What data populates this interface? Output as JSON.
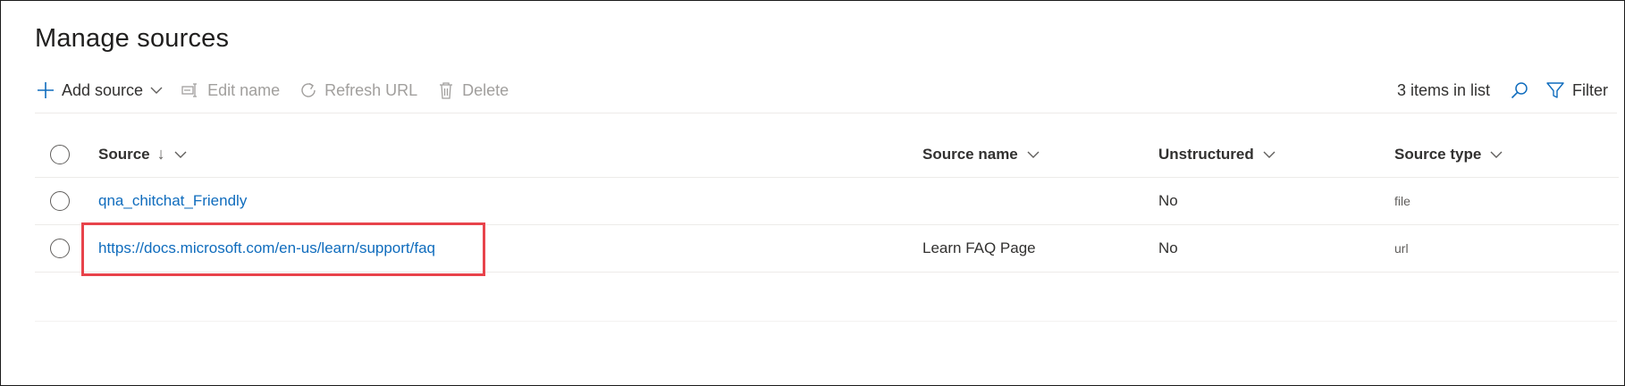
{
  "page": {
    "title": "Manage sources"
  },
  "toolbar": {
    "add_source": "Add source",
    "edit_name": "Edit name",
    "refresh_url": "Refresh URL",
    "delete": "Delete",
    "items_count": "3 items in list",
    "filter": "Filter",
    "icons": {
      "add": "plus-icon",
      "edit": "rename-icon",
      "refresh": "refresh-icon",
      "delete": "trash-icon",
      "search": "search-icon",
      "filter": "filter-icon"
    }
  },
  "table": {
    "columns": {
      "source": "Source",
      "source_sort_arrow": "↓",
      "source_name": "Source name",
      "unstructured": "Unstructured",
      "source_type": "Source type"
    },
    "rows": [
      {
        "source": "qna_chitchat_Friendly",
        "source_name": "",
        "unstructured": "No",
        "source_type": "file"
      },
      {
        "source": "https://docs.microsoft.com/en-us/learn/support/faq",
        "source_name": "Learn FAQ Page",
        "unstructured": "No",
        "source_type": "url"
      }
    ]
  },
  "colors": {
    "accent": "#0f6cbd",
    "highlight": "#e8434b",
    "disabled": "#a19f9d"
  }
}
